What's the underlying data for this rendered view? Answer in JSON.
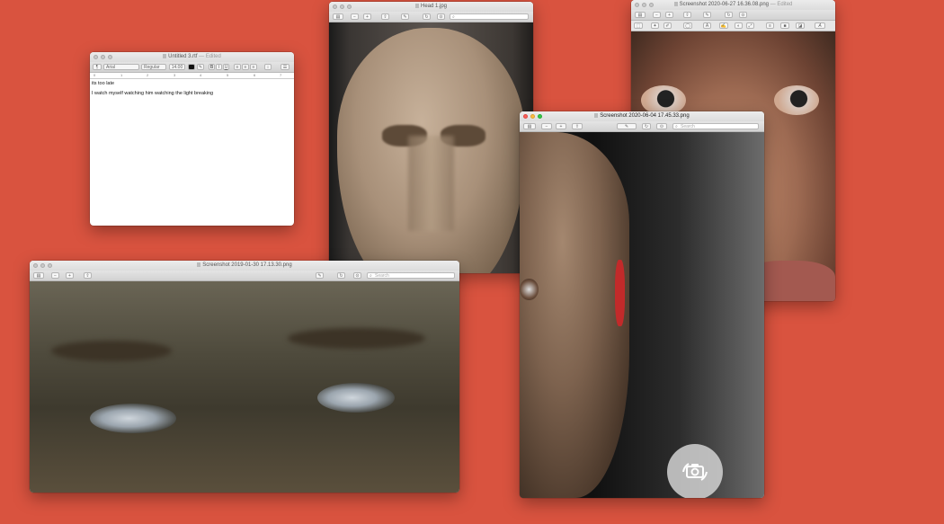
{
  "background_color": "#d9533f",
  "windows": {
    "textedit": {
      "title": "Untitled 3.rtf",
      "edited": "— Edited",
      "font_style": "Arial",
      "font_weight": "Regular",
      "font_size": "14.00",
      "ruler_ticks": [
        "0",
        "1",
        "2",
        "3",
        "4",
        "5",
        "6",
        "7"
      ],
      "lines": [
        "its too late",
        "I watch myself watching him watching the light breaking"
      ]
    },
    "stone": {
      "title": "Head 1.jpg"
    },
    "face_top_right": {
      "title": "Screenshot 2020-06-27 16.36.08.png",
      "edited": "— Edited"
    },
    "eyes_window": {
      "title": "Screenshot 2019-01-30 17.13.30.png",
      "search_placeholder": "Search"
    },
    "robot_window": {
      "title": "Screenshot 2020-06-04 17.45.33.png",
      "search_placeholder": "Search"
    }
  },
  "icons": [
    "sidebar-icon",
    "zoom-out-icon",
    "zoom-in-icon",
    "share-icon",
    "markup-icon",
    "rotate-icon",
    "search-icon",
    "camera-rotate-icon"
  ]
}
